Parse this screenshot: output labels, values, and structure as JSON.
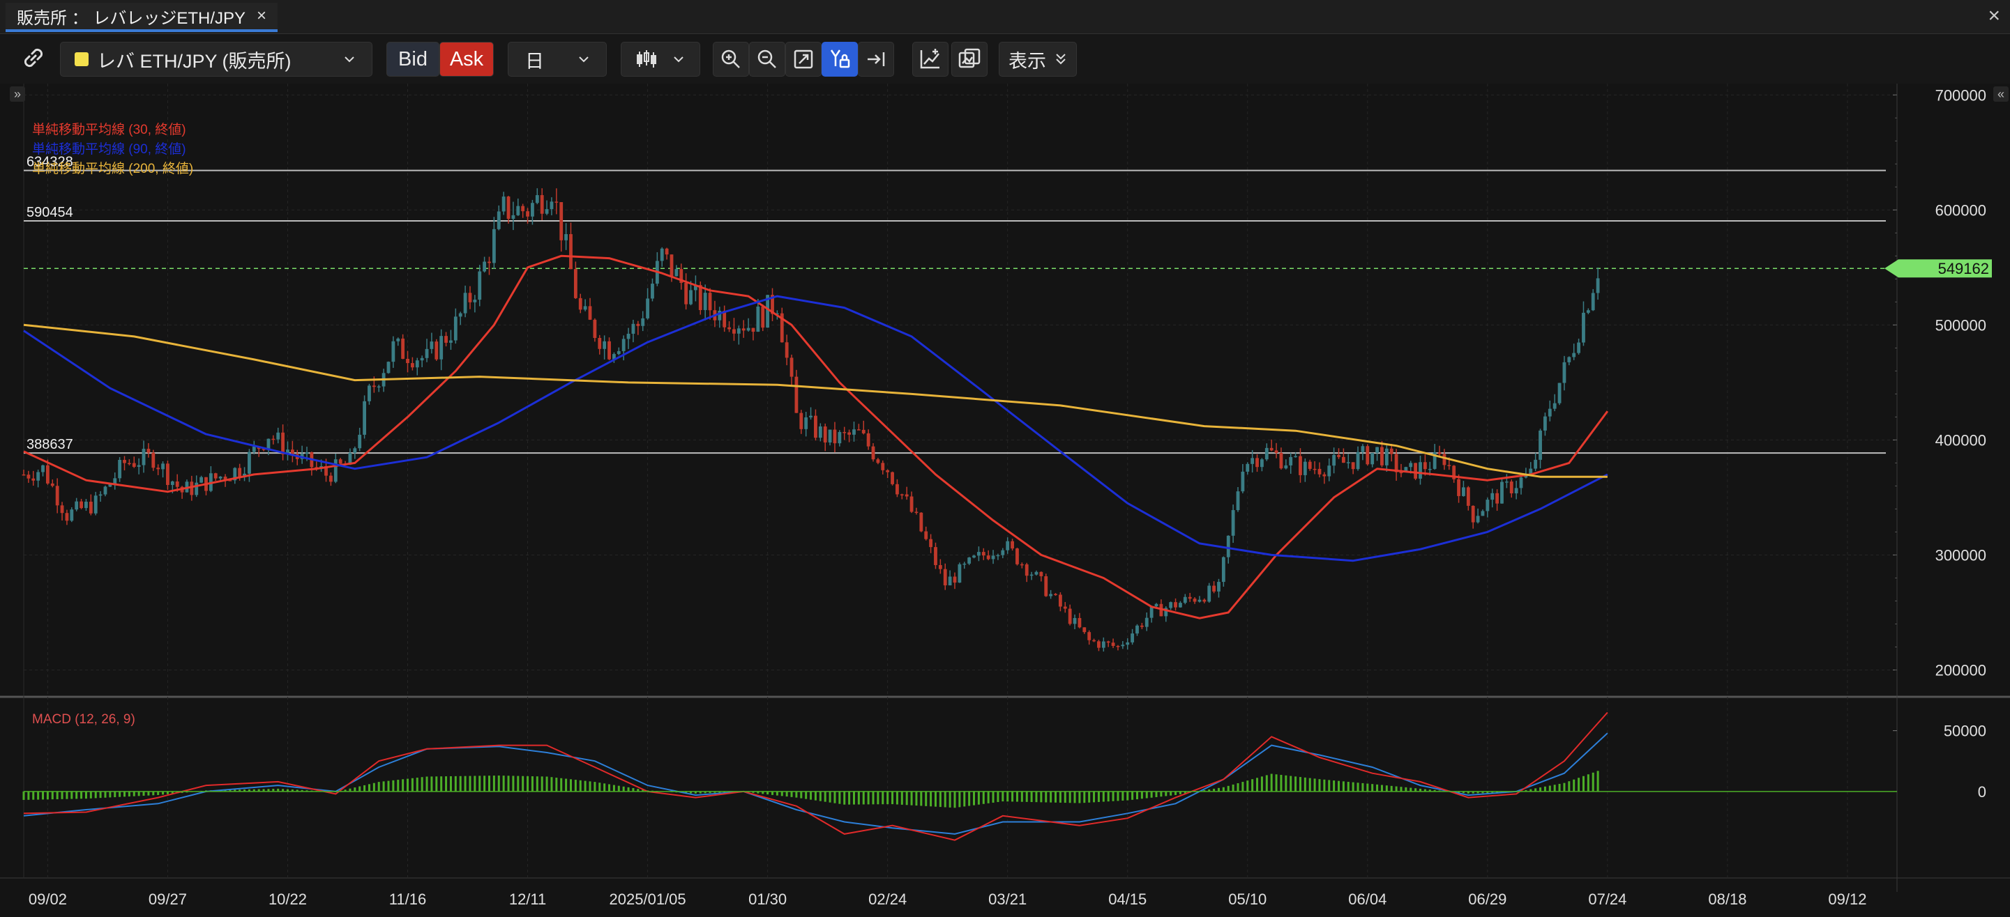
{
  "window": {
    "tab_title": "販売所 ： レバレッジETH/JPY",
    "tab_close": "×",
    "close": "×"
  },
  "toolbar": {
    "symbol": "レバ ETH/JPY (販売所)",
    "bid_label": "Bid",
    "ask_label": "Ask",
    "period": "日",
    "display_label": "表示",
    "icons": [
      "link-icon",
      "candlestick-icon",
      "zoom-in-icon",
      "zoom-out-icon",
      "fit-icon",
      "auto-scale-lock-icon",
      "jump-latest-icon",
      "indicator-icon",
      "compare-icon"
    ]
  },
  "colors": {
    "background": "#141414",
    "up": "#3a7d85",
    "down": "#c0392b",
    "sma30": "#e53a2e",
    "sma90": "#1c2fd6",
    "sma200": "#e8b43a",
    "macd": "#2d7fd8",
    "signal": "#e02a2a",
    "histogram": "#4caf27",
    "current_price": "#7be06a"
  },
  "chart_data": [
    {
      "type": "line",
      "title": "",
      "legend": [
        "単純移動平均線 (30, 終値)",
        "単純移動平均線 (90, 終値)",
        "単純移動平均線 (200, 終値)"
      ],
      "legend_position": "top-left",
      "grid": true,
      "x_ticks": [
        "09/02",
        "09/27",
        "10/22",
        "11/16",
        "12/11",
        "2025/01/05",
        "01/30",
        "02/24",
        "03/21",
        "04/15",
        "05/10",
        "06/04",
        "06/29",
        "07/24",
        "08/18",
        "09/12"
      ],
      "x_range": [
        "2024-08-28",
        "2025-09-20"
      ],
      "y_ticks": [
        200000,
        300000,
        400000,
        500000,
        600000,
        700000
      ],
      "ylim": [
        190000,
        705000
      ],
      "horizontal_lines": [
        {
          "label": "634328",
          "value": 634328
        },
        {
          "label": "590454",
          "value": 590454
        },
        {
          "label": "388637",
          "value": 388637
        }
      ],
      "current_price": {
        "label": "549162",
        "value": 549162
      },
      "series": [
        {
          "name": "price",
          "x": [
            "2024-08-28",
            "2024-09-01",
            "2024-09-06",
            "2024-09-12",
            "2024-09-18",
            "2024-09-24",
            "2024-09-30",
            "2024-10-06",
            "2024-10-12",
            "2024-10-18",
            "2024-10-24",
            "2024-10-30",
            "2024-11-04",
            "2024-11-08",
            "2024-11-13",
            "2024-11-20",
            "2024-11-26",
            "2024-12-01",
            "2024-12-06",
            "2024-12-11",
            "2024-12-16",
            "2024-12-22",
            "2024-12-28",
            "2025-01-03",
            "2025-01-08",
            "2025-01-14",
            "2025-01-20",
            "2025-01-26",
            "2025-02-01",
            "2025-02-05",
            "2025-02-12",
            "2025-02-18",
            "2025-02-24",
            "2025-03-02",
            "2025-03-08",
            "2025-03-14",
            "2025-03-20",
            "2025-03-26",
            "2025-04-01",
            "2025-04-07",
            "2025-04-13",
            "2025-04-20",
            "2025-04-27",
            "2025-05-04",
            "2025-05-09",
            "2025-05-14",
            "2025-05-22",
            "2025-05-30",
            "2025-06-06",
            "2025-06-12",
            "2025-06-20",
            "2025-06-26",
            "2025-07-02",
            "2025-07-08",
            "2025-07-12",
            "2025-07-16",
            "2025-07-19",
            "2025-07-22"
          ],
          "y": [
            370000,
            375000,
            335000,
            345000,
            380000,
            385000,
            355000,
            365000,
            375000,
            405000,
            385000,
            370000,
            380000,
            440000,
            480000,
            470000,
            500000,
            540000,
            600000,
            600000,
            620000,
            510000,
            480000,
            500000,
            560000,
            525000,
            510000,
            500000,
            520000,
            420000,
            400000,
            405000,
            375000,
            330000,
            275000,
            295000,
            310000,
            285000,
            255000,
            225000,
            220000,
            250000,
            260000,
            270000,
            380000,
            390000,
            375000,
            380000,
            390000,
            370000,
            385000,
            335000,
            355000,
            370000,
            430000,
            470000,
            510000,
            549162
          ]
        },
        {
          "name": "sma30",
          "x": [
            "2024-08-28",
            "2024-09-10",
            "2024-09-27",
            "2024-10-15",
            "2024-10-28",
            "2024-11-05",
            "2024-11-16",
            "2024-11-26",
            "2024-12-04",
            "2024-12-11",
            "2024-12-18",
            "2024-12-28",
            "2025-01-08",
            "2025-01-18",
            "2025-01-26",
            "2025-02-04",
            "2025-02-14",
            "2025-02-24",
            "2025-03-06",
            "2025-03-18",
            "2025-03-28",
            "2025-04-10",
            "2025-04-20",
            "2025-04-30",
            "2025-05-06",
            "2025-05-16",
            "2025-05-28",
            "2025-06-06",
            "2025-06-18",
            "2025-06-29",
            "2025-07-08",
            "2025-07-16",
            "2025-07-24"
          ],
          "y": [
            390000,
            365000,
            355000,
            370000,
            375000,
            380000,
            420000,
            460000,
            500000,
            550000,
            560000,
            558000,
            545000,
            530000,
            525000,
            500000,
            450000,
            410000,
            370000,
            330000,
            300000,
            280000,
            255000,
            245000,
            250000,
            300000,
            350000,
            375000,
            370000,
            365000,
            370000,
            380000,
            425000
          ]
        },
        {
          "name": "sma90",
          "x": [
            "2024-08-28",
            "2024-09-15",
            "2024-10-05",
            "2024-10-25",
            "2024-11-05",
            "2024-11-20",
            "2024-12-05",
            "2024-12-20",
            "2025-01-05",
            "2025-01-20",
            "2025-02-01",
            "2025-02-15",
            "2025-03-01",
            "2025-03-15",
            "2025-04-01",
            "2025-04-15",
            "2025-04-30",
            "2025-05-15",
            "2025-06-01",
            "2025-06-15",
            "2025-06-29",
            "2025-07-10",
            "2025-07-24"
          ],
          "y": [
            495000,
            445000,
            405000,
            385000,
            375000,
            385000,
            415000,
            450000,
            485000,
            510000,
            525000,
            515000,
            490000,
            445000,
            390000,
            345000,
            310000,
            300000,
            295000,
            305000,
            320000,
            340000,
            370000
          ]
        },
        {
          "name": "sma200",
          "x": [
            "2024-08-28",
            "2024-09-20",
            "2024-10-15",
            "2024-11-05",
            "2024-12-01",
            "2025-01-01",
            "2025-02-01",
            "2025-03-01",
            "2025-04-01",
            "2025-05-01",
            "2025-05-20",
            "2025-06-10",
            "2025-06-29",
            "2025-07-10",
            "2025-07-24"
          ],
          "y": [
            500000,
            490000,
            470000,
            452000,
            455000,
            450000,
            448000,
            440000,
            430000,
            412000,
            408000,
            395000,
            375000,
            368000,
            368000
          ]
        }
      ]
    },
    {
      "type": "line",
      "title": "",
      "legend": [
        "MACD (12, 26, 9)"
      ],
      "legend_position": "top-left",
      "y_ticks": [
        0,
        50000
      ],
      "ylim": [
        -70000,
        75000
      ],
      "series": [
        {
          "name": "macd",
          "x": [
            "2024-08-28",
            "2024-09-10",
            "2024-09-25",
            "2024-10-05",
            "2024-10-20",
            "2024-11-01",
            "2024-11-10",
            "2024-11-20",
            "2024-12-05",
            "2024-12-15",
            "2024-12-25",
            "2025-01-05",
            "2025-01-15",
            "2025-01-25",
            "2025-02-05",
            "2025-02-15",
            "2025-02-25",
            "2025-03-10",
            "2025-03-20",
            "2025-04-05",
            "2025-04-15",
            "2025-04-25",
            "2025-05-05",
            "2025-05-15",
            "2025-05-25",
            "2025-06-05",
            "2025-06-15",
            "2025-06-25",
            "2025-07-05",
            "2025-07-15",
            "2025-07-24"
          ],
          "y": [
            -20000,
            -15000,
            -10000,
            0,
            5000,
            0,
            20000,
            35000,
            37000,
            32000,
            25000,
            5000,
            -3000,
            0,
            -15000,
            -25000,
            -30000,
            -35000,
            -25000,
            -25000,
            -18000,
            -10000,
            10000,
            38000,
            30000,
            20000,
            5000,
            -3000,
            0,
            15000,
            48000
          ]
        },
        {
          "name": "signal",
          "x": [
            "2024-08-28",
            "2024-09-10",
            "2024-09-25",
            "2024-10-05",
            "2024-10-20",
            "2024-11-01",
            "2024-11-10",
            "2024-11-20",
            "2024-12-05",
            "2024-12-15",
            "2024-12-25",
            "2025-01-05",
            "2025-01-15",
            "2025-01-25",
            "2025-02-05",
            "2025-02-15",
            "2025-02-25",
            "2025-03-10",
            "2025-03-20",
            "2025-04-05",
            "2025-04-15",
            "2025-04-25",
            "2025-05-05",
            "2025-05-15",
            "2025-05-25",
            "2025-06-05",
            "2025-06-15",
            "2025-06-25",
            "2025-07-05",
            "2025-07-15",
            "2025-07-24"
          ],
          "y": [
            -18000,
            -17000,
            -5000,
            5000,
            8000,
            -2000,
            25000,
            35000,
            38000,
            38000,
            20000,
            0,
            -5000,
            0,
            -12000,
            -35000,
            -28000,
            -40000,
            -20000,
            -28000,
            -22000,
            -5000,
            10000,
            45000,
            28000,
            15000,
            8000,
            -5000,
            -2000,
            25000,
            65000
          ]
        }
      ]
    }
  ],
  "ui": {
    "expand_left": "»",
    "expand_right": "«"
  }
}
